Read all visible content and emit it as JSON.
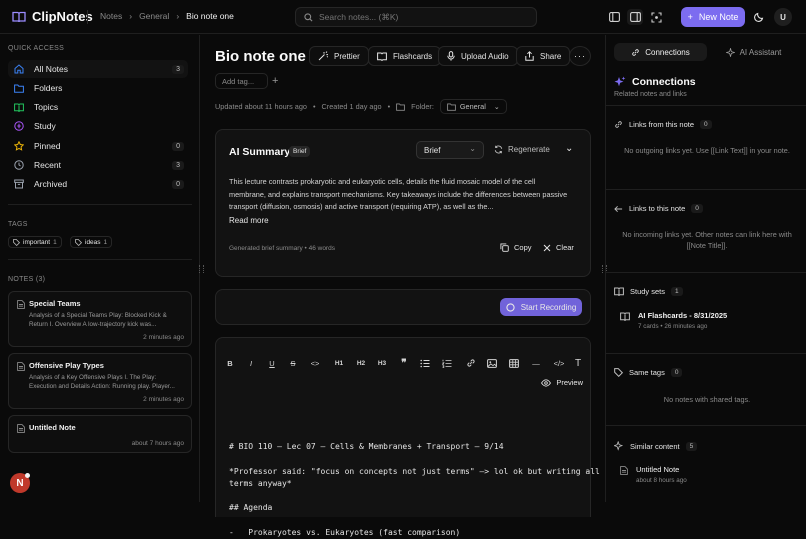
{
  "app": {
    "name": "ClipNotes"
  },
  "breadcrumb": [
    "Notes",
    "General",
    "Bio note one"
  ],
  "search": {
    "placeholder": "Search notes... (⌘K)"
  },
  "header": {
    "new_note_label": "New Note",
    "avatar_initial": "U"
  },
  "sidebar": {
    "quick_access_label": "QUICK ACCESS",
    "items": [
      {
        "label": "All Notes",
        "count": "3",
        "icon": "home-icon",
        "color": "#3b82f6"
      },
      {
        "label": "Folders",
        "count": "",
        "icon": "folder-icon",
        "color": "#3b82f6"
      },
      {
        "label": "Topics",
        "count": "",
        "icon": "book-icon",
        "color": "#22c55e"
      },
      {
        "label": "Study",
        "count": "",
        "icon": "study-icon",
        "color": "#a855f7"
      },
      {
        "label": "Pinned",
        "count": "0",
        "icon": "star-icon",
        "color": "#eab308"
      },
      {
        "label": "Recent",
        "count": "3",
        "icon": "clock-icon",
        "color": "#9ca3af"
      },
      {
        "label": "Archived",
        "count": "0",
        "icon": "archive-icon",
        "color": "#9ca3af"
      }
    ],
    "tags_label": "TAGS",
    "tags": [
      {
        "name": "important",
        "count": "1"
      },
      {
        "name": "ideas",
        "count": "1"
      }
    ],
    "notes_label": "NOTES (3)",
    "notes": [
      {
        "title": "Special Teams",
        "excerpt": "Analysis of a Special Teams Play: Blocked Kick & Return I. Overview A low-trajectory kick was...",
        "date": "2 minutes ago"
      },
      {
        "title": "Offensive Play Types",
        "excerpt": "Analysis of a Key Offensive Plays I. The Play: Execution and Details Action: Running play. Player...",
        "date": "2 minutes ago"
      },
      {
        "title": "Untitled Note",
        "excerpt": "",
        "date": "about 7 hours ago"
      }
    ],
    "fab_initial": "N"
  },
  "note": {
    "title": "Bio note one",
    "toolbar": {
      "prettier": "Prettier",
      "flashcards": "Flashcards",
      "upload_audio": "Upload Audio",
      "share": "Share"
    },
    "add_tag_placeholder": "Add tag...",
    "updated": "Updated about 11 hours ago",
    "created": "Created 1 day ago",
    "folder_label": "Folder:",
    "folder_value": "General"
  },
  "ai_summary": {
    "title": "AI Summary",
    "badge": "Brief",
    "mode": "Brief",
    "regenerate": "Regenerate",
    "text": "This lecture contrasts prokaryotic and eukaryotic cells, details the fluid mosaic model of the cell membrane, and explains transport mechanisms. Key takeaways include the differences between passive transport (diffusion, osmosis) and active transport (requiring ATP), as well as the...",
    "read_more": "Read more",
    "footer": "Generated brief summary • 46 words",
    "copy": "Copy",
    "clear": "Clear"
  },
  "recording": {
    "label": "Start Recording"
  },
  "editor": {
    "preview_label": "Preview",
    "lines": [
      "# BIO 110 — Lec 07 — Cells & Membranes + Transport — 9/14",
      "",
      "*Professor said: \"focus on concepts not just terms\" —> lol ok but writing all",
      "terms anyway*",
      "",
      "## Agenda",
      "",
      "-   Prokaryotes vs. Eukaryotes (fast comparison)"
    ]
  },
  "right_panel": {
    "tabs": [
      "Connections",
      "AI Assistant"
    ],
    "heading": "Connections",
    "subheading": "Related notes and links",
    "links_from": {
      "label": "Links from this note",
      "count": "0",
      "empty": "No outgoing links yet. Use [[Link Text]] in your note."
    },
    "links_to": {
      "label": "Links to this note",
      "count": "0",
      "empty": "No incoming links yet. Other notes can link here with [[Note Title]]."
    },
    "study_sets": {
      "label": "Study sets",
      "count": "1",
      "item_title": "AI Flashcards - 8/31/2025",
      "item_sub": "7 cards • 26 minutes ago"
    },
    "same_tags": {
      "label": "Same tags",
      "count": "0",
      "empty": "No notes with shared tags."
    },
    "similar": {
      "label": "Similar content",
      "count": "5",
      "item_title": "Untitled Note",
      "item_sub": "about 8 hours ago"
    }
  },
  "colors": {
    "accent": "#7c6cf0",
    "background": "#0a0a0a",
    "border": "#262626"
  }
}
